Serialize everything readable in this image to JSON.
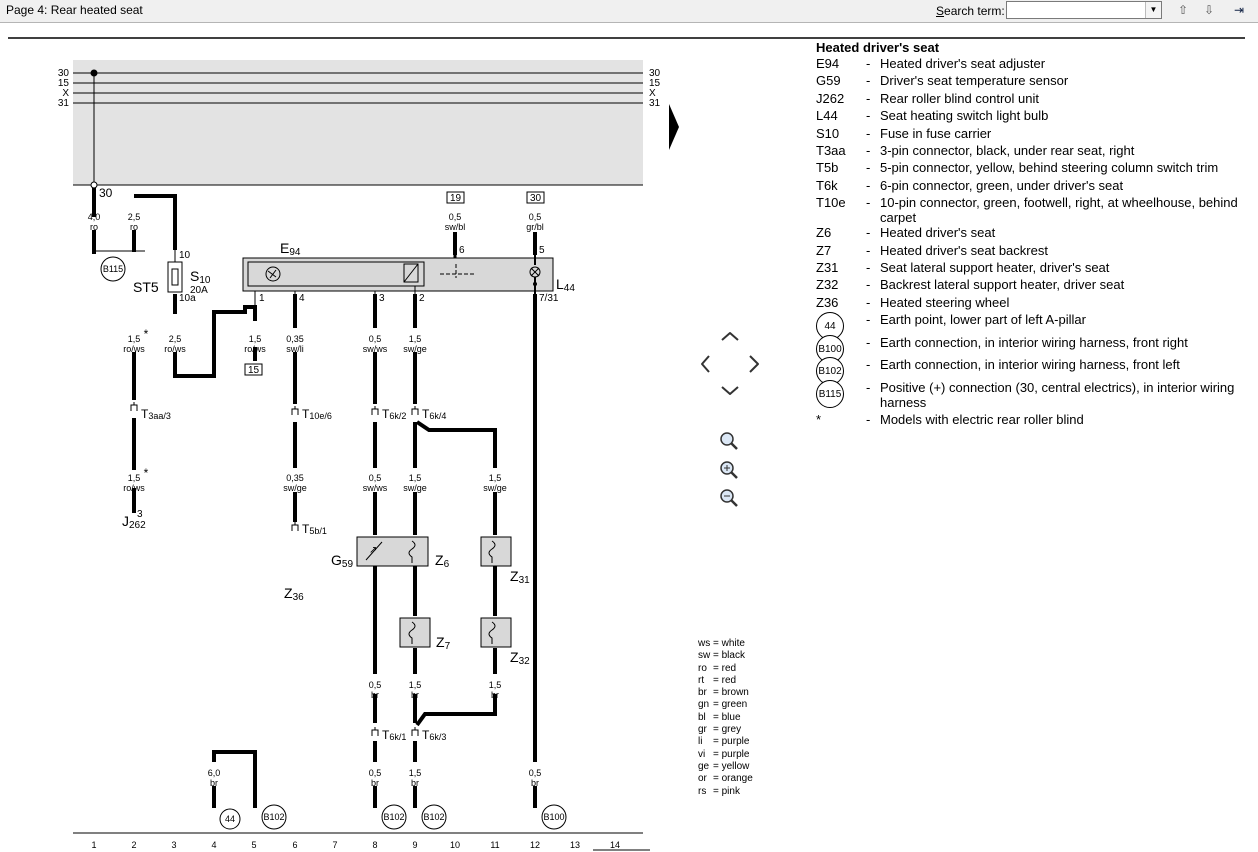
{
  "toolbar": {
    "title": "Page 4: Rear heated seat",
    "search_label_pre": "S",
    "search_label_post": "earch term:",
    "search_value": "",
    "search_placeholder": ""
  },
  "rails": {
    "left_labels": [
      "30",
      "15",
      "X",
      "31"
    ],
    "right_labels": [
      "30",
      "15",
      "X",
      "31"
    ],
    "terminal_30": "30"
  },
  "diagram": {
    "component_labels": {
      "st5": "ST5",
      "s10": "S",
      "s10_sub": "10",
      "s10_rating": "20A",
      "e94": "E",
      "e94_sub": "94",
      "l44": "L",
      "l44_sub": "44",
      "g59": "G",
      "g59_sub": "59",
      "z6": "Z",
      "z6_sub": "6",
      "z7": "Z",
      "z7_sub": "7",
      "z31": "Z",
      "z31_sub": "31",
      "z32": "Z",
      "z32_sub": "32",
      "z36": "Z",
      "z36_sub": "36",
      "j262": "J",
      "j262_sub": "262"
    },
    "pin_labels": {
      "p10": "10",
      "p10a": "10a",
      "p1": "1",
      "p4": "4",
      "p3": "3",
      "p2": "2",
      "p6": "6",
      "p5": "5",
      "p731": "7/31",
      "j262_pin": "3"
    },
    "boxed_refs": {
      "r19": "19",
      "r30": "30",
      "r15": "15"
    },
    "wires": [
      {
        "size": "4,0",
        "color": "ro"
      },
      {
        "size": "2,5",
        "color": "ro"
      },
      {
        "size": "1,5",
        "color": "ro/ws",
        "mark": "*"
      },
      {
        "size": "2,5",
        "color": "ro/ws"
      },
      {
        "size": "1,5",
        "color": "ro/ws"
      },
      {
        "size": "0,35",
        "color": "sw/li"
      },
      {
        "size": "0,5",
        "color": "sw/ws"
      },
      {
        "size": "1,5",
        "color": "sw/ge"
      },
      {
        "size": "0,5",
        "color": "sw/bl"
      },
      {
        "size": "0,5",
        "color": "gr/bl"
      },
      {
        "size": "1,5",
        "color": "ro/ws",
        "mark": "*"
      },
      {
        "size": "0,35",
        "color": "sw/ge"
      },
      {
        "size": "0,5",
        "color": "sw/ws"
      },
      {
        "size": "1,5",
        "color": "sw/ge"
      },
      {
        "size": "1,5",
        "color": "sw/ge"
      },
      {
        "size": "0,5",
        "color": "br"
      },
      {
        "size": "1,5",
        "color": "br"
      },
      {
        "size": "1,5",
        "color": "br"
      },
      {
        "size": "6,0",
        "color": "br"
      },
      {
        "size": "0,5",
        "color": "br"
      },
      {
        "size": "1,5",
        "color": "br"
      },
      {
        "size": "0,5",
        "color": "br"
      }
    ],
    "connectors": [
      {
        "name": "T",
        "sub": "3aa/3"
      },
      {
        "name": "T",
        "sub": "10e/6"
      },
      {
        "name": "T",
        "sub": "6k/2"
      },
      {
        "name": "T",
        "sub": "6k/4"
      },
      {
        "name": "T",
        "sub": "5b/1"
      },
      {
        "name": "T",
        "sub": "6k/1"
      },
      {
        "name": "T",
        "sub": "6k/3"
      }
    ],
    "earth_points": [
      "B115",
      "44",
      "B102",
      "B102",
      "B102",
      "B100"
    ],
    "column_numbers": [
      "1",
      "2",
      "3",
      "4",
      "5",
      "6",
      "7",
      "8",
      "9",
      "10",
      "11",
      "12",
      "13",
      "14"
    ]
  },
  "legend": {
    "heading": "Heated driver's seat",
    "items": [
      {
        "code": "E94",
        "desc": "Heated driver's seat adjuster"
      },
      {
        "code": "G59",
        "desc": "Driver's seat temperature sensor"
      },
      {
        "code": "J262",
        "desc": "Rear roller blind control unit"
      },
      {
        "code": "L44",
        "desc": "Seat heating switch light bulb"
      },
      {
        "code": "S10",
        "desc": "Fuse in fuse carrier"
      },
      {
        "code": "T3aa",
        "desc": "3-pin connector, black, under rear seat, right"
      },
      {
        "code": "T5b",
        "desc": "5-pin connector, yellow, behind steering column switch trim"
      },
      {
        "code": "T6k",
        "desc": "6-pin connector, green, under driver's seat"
      },
      {
        "code": "T10e",
        "desc": "10-pin connector, green, footwell, right, at wheelhouse, behind carpet"
      },
      {
        "code": "Z6",
        "desc": "Heated driver's seat"
      },
      {
        "code": "Z7",
        "desc": "Heated driver's seat backrest"
      },
      {
        "code": "Z31",
        "desc": "Seat lateral support heater, driver's seat"
      },
      {
        "code": "Z32",
        "desc": "Backrest lateral support heater, driver seat"
      },
      {
        "code": "Z36",
        "desc": "Heated steering wheel"
      }
    ],
    "earth_items": [
      {
        "code": "44",
        "desc": "Earth point, lower part of left A-pillar"
      },
      {
        "code": "B100",
        "desc": "Earth connection, in interior wiring harness, front right"
      },
      {
        "code": "B102",
        "desc": "Earth connection, in interior wiring harness, front left"
      },
      {
        "code": "B115",
        "desc": "Positive (+) connection (30, central electrics), in interior wiring harness"
      }
    ],
    "note": {
      "code": "*",
      "desc": "Models with electric rear roller blind"
    }
  },
  "color_codes": [
    {
      "abbr": "ws",
      "name": "= white"
    },
    {
      "abbr": "sw",
      "name": "= black"
    },
    {
      "abbr": "ro",
      "name": "= red"
    },
    {
      "abbr": "rt",
      "name": "= red"
    },
    {
      "abbr": "br",
      "name": "= brown"
    },
    {
      "abbr": "gn",
      "name": "= green"
    },
    {
      "abbr": "bl",
      "name": "= blue"
    },
    {
      "abbr": "gr",
      "name": "= grey"
    },
    {
      "abbr": "li",
      "name": "= purple"
    },
    {
      "abbr": "vi",
      "name": "= purple"
    },
    {
      "abbr": "ge",
      "name": "= yellow"
    },
    {
      "abbr": "or",
      "name": "= orange"
    },
    {
      "abbr": "rs",
      "name": "= pink"
    }
  ],
  "nav": {
    "up": "up-arrow-icon",
    "left": "left-arrow-icon",
    "right": "right-arrow-icon",
    "down": "down-arrow-icon",
    "zoom_fit": "magnifier-icon",
    "zoom_in": "zoom-in-icon",
    "zoom_out": "zoom-out-icon",
    "next_page": "next-page-icon"
  },
  "colors": {
    "rail_bg": "#e3e3e3",
    "component_bg": "#d8d8d8",
    "toolbar_bg": "#f0f0f0"
  }
}
